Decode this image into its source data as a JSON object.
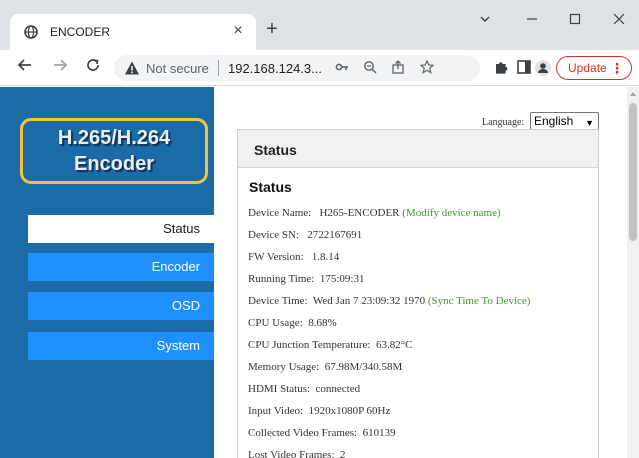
{
  "browser": {
    "tab_title": "ENCODER",
    "tab_close": "×",
    "new_tab": "+",
    "security_label": "Not secure",
    "url": "192.168.124.3...",
    "update_label": "Update",
    "update_menu": "⋮"
  },
  "sidebar": {
    "logo_line1": "H.265/H.264",
    "logo_line2": "Encoder",
    "items": [
      {
        "label": "Status"
      },
      {
        "label": "Encoder"
      },
      {
        "label": "OSD"
      },
      {
        "label": "System"
      }
    ]
  },
  "language": {
    "label": "Language:",
    "selected": "English"
  },
  "panel": {
    "header": "Status",
    "section_title": "Status",
    "rows": [
      {
        "label": "Device Name:",
        "value": "H265-ENCODER",
        "link": "(Modify device name)"
      },
      {
        "label": "Device SN:",
        "value": "2722167691"
      },
      {
        "label": "FW Version:",
        "value": "1.8.14"
      },
      {
        "label": "Running Time:",
        "value": "175:09:31"
      },
      {
        "label": "Device Time:",
        "value": "Wed Jan 7 23:09:32 1970",
        "link": "(Sync Time To Device)"
      },
      {
        "label": "CPU Usage:",
        "value": "8.68%"
      },
      {
        "label": "CPU Junction Temperature:",
        "value": "63.82°C"
      },
      {
        "label": "Memory Usage:",
        "value": "67.98M/340.58M"
      },
      {
        "label": "HDMI Status:",
        "value": "connected"
      },
      {
        "label": "Input Video:",
        "value": "1920x1080P 60Hz"
      },
      {
        "label": "Collected Video Frames:",
        "value": "610139"
      },
      {
        "label": "Lost Video Frames:",
        "value": "2"
      }
    ]
  },
  "colors": {
    "sidebar_bg": "#1b6ba7",
    "menu_bg": "#1e90ff",
    "logo_border": "#f5c33b",
    "link_green": "#3d9a2e",
    "update_red": "#d93025"
  }
}
